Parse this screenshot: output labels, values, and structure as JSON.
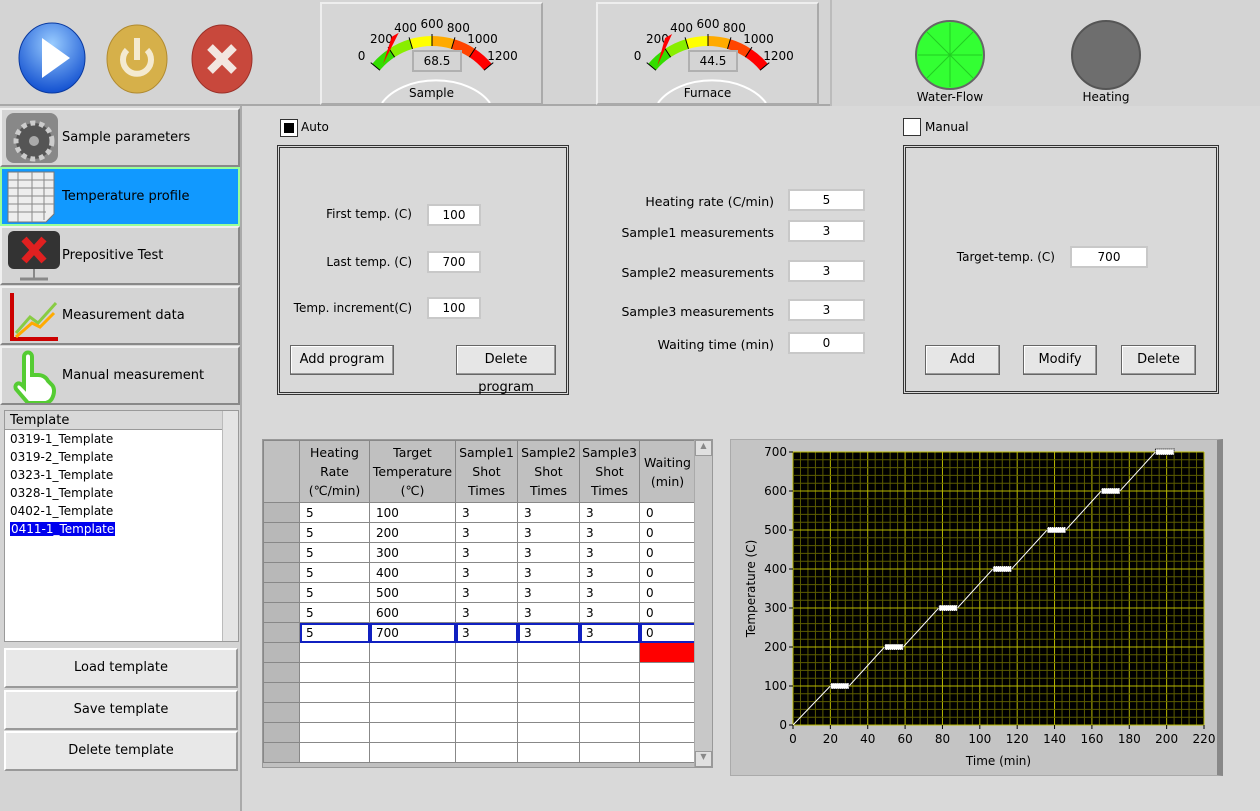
{
  "toolbar": {
    "buttons": [
      {
        "name": "run",
        "icon": "play-icon"
      },
      {
        "name": "power",
        "icon": "power-icon"
      },
      {
        "name": "stop",
        "icon": "close-icon"
      }
    ]
  },
  "gauges": [
    {
      "label": "Sample",
      "value": "68.5",
      "ticks": [
        "0",
        "200",
        "400",
        "600",
        "800",
        "1000",
        "1200"
      ],
      "min": 0,
      "max": 1200
    },
    {
      "label": "Furnace",
      "value": "44.5",
      "ticks": [
        "0",
        "200",
        "400",
        "600",
        "800",
        "1000",
        "1200"
      ],
      "min": 0,
      "max": 1200
    }
  ],
  "indicators": [
    {
      "label": "Water-Flow",
      "on": true,
      "color": "#33ff33"
    },
    {
      "label": "Heating",
      "on": false,
      "color": "#6e6e6e"
    }
  ],
  "nav": [
    {
      "label": "Sample parameters",
      "icon": "gear-icon"
    },
    {
      "label": "Temperature profile",
      "icon": "spreadsheet-icon",
      "active": true
    },
    {
      "label": "Prepositive Test",
      "icon": "network-error-icon"
    },
    {
      "label": "Measurement data",
      "icon": "chart-icon"
    },
    {
      "label": "Manual measurement",
      "icon": "hand-pointer-icon"
    }
  ],
  "templates": {
    "header": "Template",
    "items": [
      "0319-1_Template",
      "0319-2_Template",
      "0323-1_Template",
      "0328-1_Template",
      "0402-1_Template",
      "0411-1_Template"
    ],
    "selected": "0411-1_Template"
  },
  "template_buttons": {
    "load": "Load template",
    "save": "Save template",
    "delete": "Delete template"
  },
  "auto": {
    "label": "Auto",
    "checked": true,
    "first_label": "First temp. (C)",
    "first": "100",
    "last_label": "Last temp. (C)",
    "last": "700",
    "inc_label": "Temp. increment(C)",
    "inc": "100",
    "add": "Add program",
    "delete": "Delete program"
  },
  "params": [
    {
      "label": "Heating rate (C/min)",
      "value": "5"
    },
    {
      "label": "Sample1 measurements",
      "value": "3"
    },
    {
      "label": "Sample2 measurements",
      "value": "3"
    },
    {
      "label": "Sample3 measurements",
      "value": "3"
    },
    {
      "label": "Waiting time (min)",
      "value": "0"
    }
  ],
  "manual": {
    "label": "Manual",
    "checked": false,
    "target_label": "Target-temp. (C)",
    "target": "700",
    "add": "Add",
    "modify": "Modify",
    "delete": "Delete"
  },
  "table": {
    "headers": [
      [
        "Heating",
        "Rate",
        "(℃/min)"
      ],
      [
        "Target",
        "Temperature",
        "(℃)"
      ],
      [
        "Sample1",
        "Shot",
        "Times"
      ],
      [
        "Sample2",
        "Shot",
        "Times"
      ],
      [
        "Sample3",
        "Shot",
        "Times"
      ],
      [
        "Waiting",
        "(min)",
        ""
      ]
    ],
    "rows": [
      [
        "5",
        "100",
        "3",
        "3",
        "3",
        "0"
      ],
      [
        "5",
        "200",
        "3",
        "3",
        "3",
        "0"
      ],
      [
        "5",
        "300",
        "3",
        "3",
        "3",
        "0"
      ],
      [
        "5",
        "400",
        "3",
        "3",
        "3",
        "0"
      ],
      [
        "5",
        "500",
        "3",
        "3",
        "3",
        "0"
      ],
      [
        "5",
        "600",
        "3",
        "3",
        "3",
        "0"
      ],
      [
        "5",
        "700",
        "3",
        "3",
        "3",
        "0"
      ]
    ],
    "empty_rows": 6,
    "selected_row": 6
  },
  "chart_data": {
    "type": "line",
    "xlabel": "Time (min)",
    "ylabel": "Temperature  (C)",
    "xlim": [
      0,
      220
    ],
    "ylim": [
      0,
      700
    ],
    "xticks": [
      "0",
      "20",
      "40",
      "60",
      "80",
      "100",
      "120",
      "140",
      "160",
      "180",
      "200",
      "220"
    ],
    "yticks": [
      "0",
      "100",
      "200",
      "300",
      "400",
      "500",
      "600",
      "700"
    ],
    "grid": true,
    "background": "#000000",
    "grid_color": "#b8b800",
    "line_color": "#ffffff",
    "x": [
      0,
      20,
      30,
      49,
      59,
      78,
      88,
      107,
      117,
      136,
      146,
      165,
      175,
      194,
      204
    ],
    "y": [
      0,
      100,
      100,
      200,
      200,
      300,
      300,
      400,
      400,
      500,
      500,
      600,
      600,
      700,
      700
    ],
    "holds": [
      [
        20,
        30,
        100
      ],
      [
        49,
        59,
        200
      ],
      [
        78,
        88,
        300
      ],
      [
        107,
        117,
        400
      ],
      [
        136,
        146,
        500
      ],
      [
        165,
        175,
        600
      ],
      [
        194,
        204,
        700
      ]
    ]
  }
}
